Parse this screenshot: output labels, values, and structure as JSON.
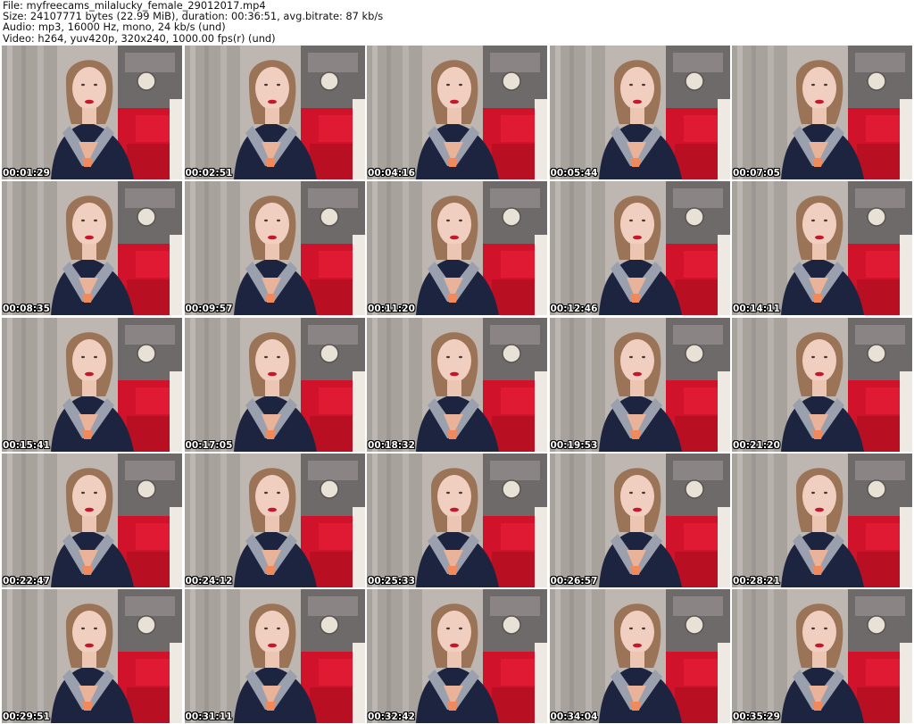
{
  "header": {
    "file_line": "File: myfreecams_milalucky_female_29012017.mp4",
    "size_line": "Size: 24107771 bytes (22.99 MiB), duration: 00:36:51, avg.bitrate: 87 kb/s",
    "audio_line": "Audio: mp3, 16000 Hz, mono, 24 kb/s (und)",
    "video_line": "Video: h264, yuv420p, 320x240, 1000.00 fps(r) (und)"
  },
  "thumbnails": [
    {
      "timestamp": "00:01:29"
    },
    {
      "timestamp": "00:02:51"
    },
    {
      "timestamp": "00:04:16"
    },
    {
      "timestamp": "00:05:44"
    },
    {
      "timestamp": "00:07:05"
    },
    {
      "timestamp": "00:08:35"
    },
    {
      "timestamp": "00:09:57"
    },
    {
      "timestamp": "00:11:20"
    },
    {
      "timestamp": "00:12:46"
    },
    {
      "timestamp": "00:14:11"
    },
    {
      "timestamp": "00:15:41"
    },
    {
      "timestamp": "00:17:05"
    },
    {
      "timestamp": "00:18:32"
    },
    {
      "timestamp": "00:19:53"
    },
    {
      "timestamp": "00:21:20"
    },
    {
      "timestamp": "00:22:47"
    },
    {
      "timestamp": "00:24:12"
    },
    {
      "timestamp": "00:25:33"
    },
    {
      "timestamp": "00:26:57"
    },
    {
      "timestamp": "00:28:21"
    },
    {
      "timestamp": "00:29:51"
    },
    {
      "timestamp": "00:31:11"
    },
    {
      "timestamp": "00:32:42"
    },
    {
      "timestamp": "00:34:04"
    },
    {
      "timestamp": "00:35:29"
    }
  ]
}
